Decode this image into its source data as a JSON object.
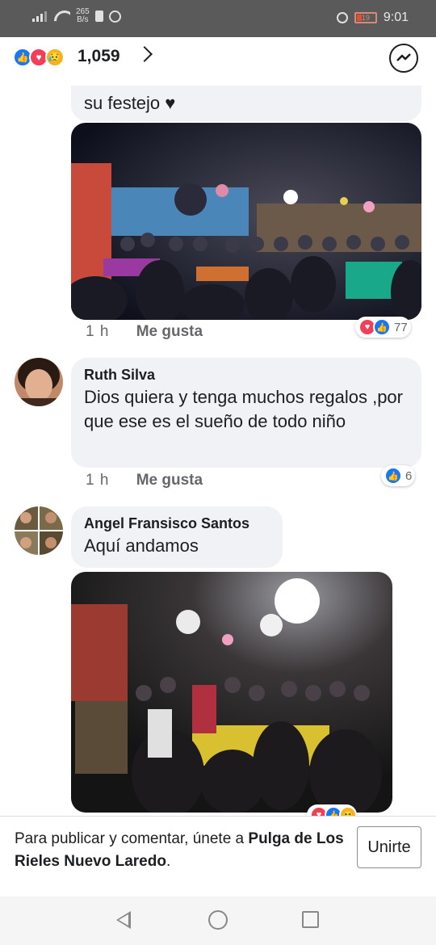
{
  "status_bar": {
    "net_speed_top": "265",
    "net_speed_bottom": "B/s",
    "battery": "19",
    "time": "9:01"
  },
  "header": {
    "reaction_count": "1,059",
    "reactions": [
      "like-icon",
      "love-icon",
      "sad-icon"
    ]
  },
  "comments": [
    {
      "text": "su festejo ♥",
      "time": "1 h",
      "like_label": "Me gusta",
      "reaction_count": "77"
    },
    {
      "author": "Ruth Silva",
      "text": "Dios quiera y tenga muchos regalos ,por que ese es el sueño de todo niño",
      "time": "1 h",
      "like_label": "Me gusta",
      "reaction_count": "6"
    },
    {
      "author": "Angel Fransisco Santos",
      "text": "Aquí andamos"
    }
  ],
  "join_bar": {
    "prefix": "Para publicar y comentar, únete a ",
    "group": "Pulga de Los Rieles Nuevo Laredo",
    "suffix": ".",
    "button": "Unirte"
  },
  "colors": {
    "facebook_blue": "#1877f2",
    "love_red": "#f33e58",
    "bubble_gray": "#f0f2f5"
  }
}
